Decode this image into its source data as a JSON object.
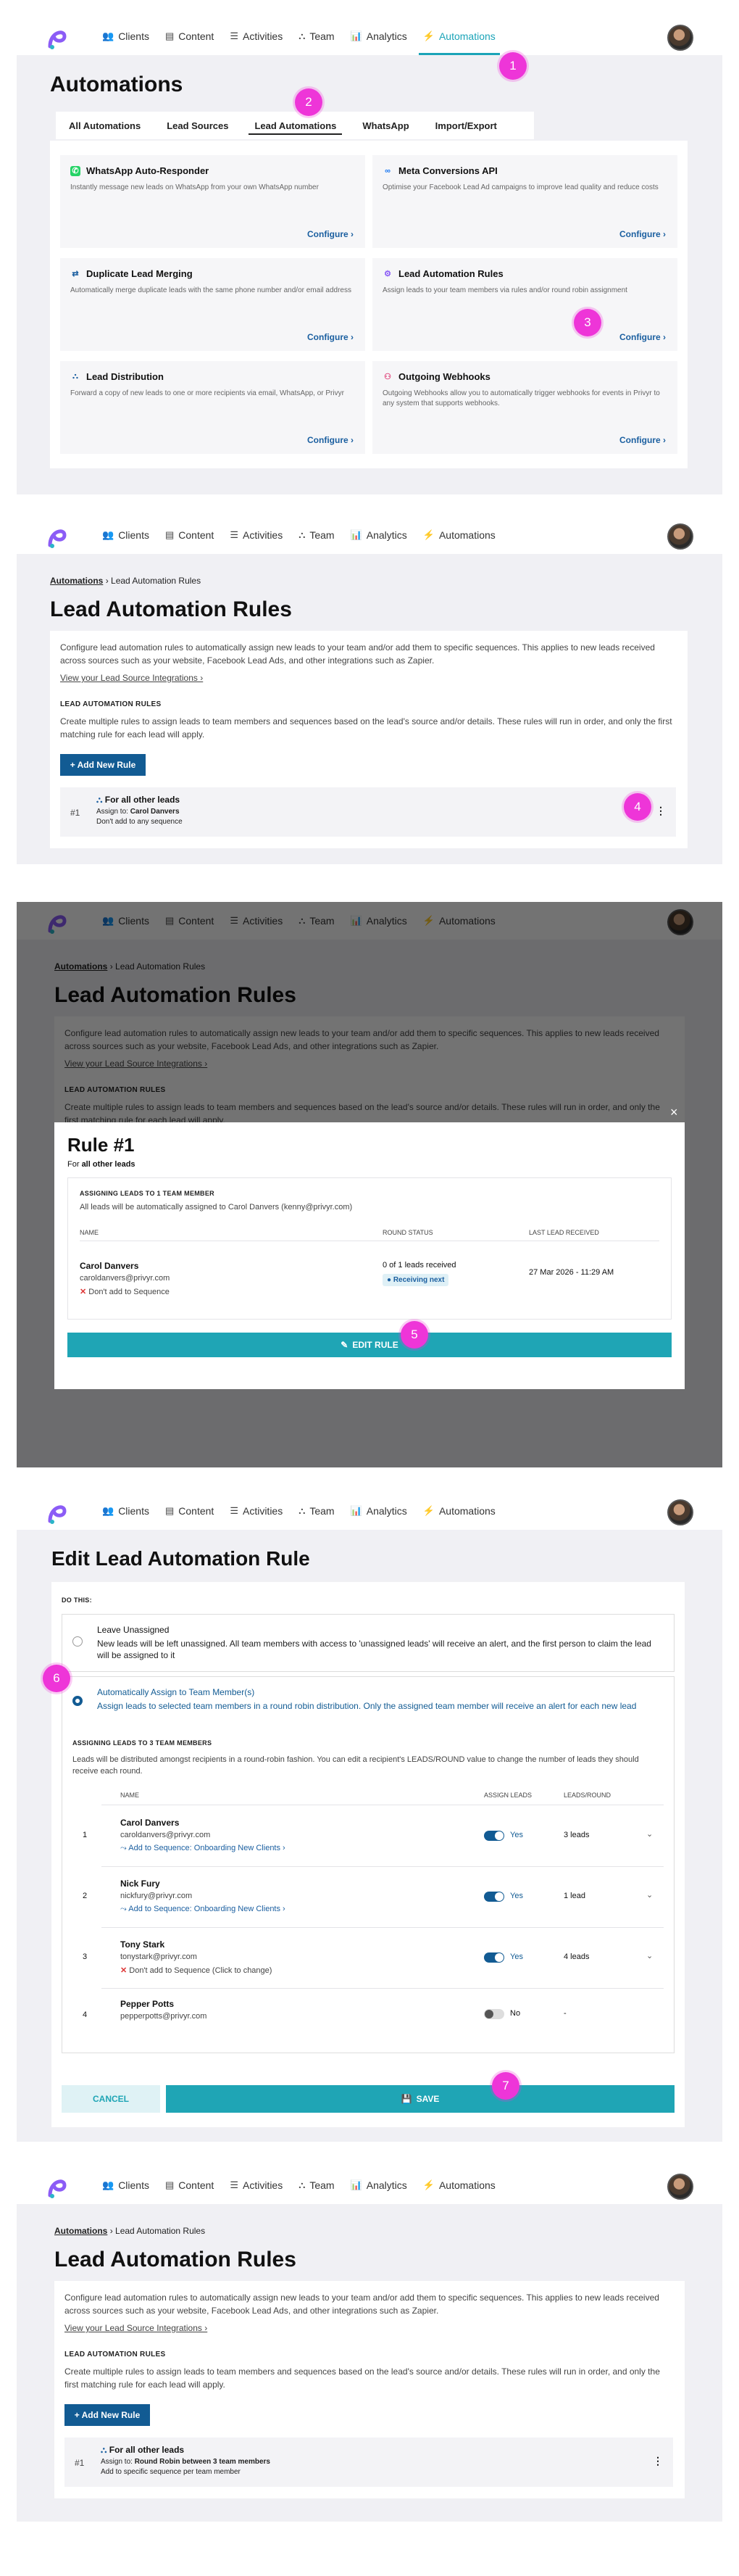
{
  "nav": {
    "items": [
      {
        "label": "Clients",
        "icon": "users-icon"
      },
      {
        "label": "Content",
        "icon": "document-icon"
      },
      {
        "label": "Activities",
        "icon": "list-icon"
      },
      {
        "label": "Team",
        "icon": "team-icon"
      },
      {
        "label": "Analytics",
        "icon": "chart-icon"
      },
      {
        "label": "Automations",
        "icon": "bolt-icon"
      }
    ]
  },
  "markers": [
    "1",
    "2",
    "3",
    "4",
    "5",
    "6",
    "7"
  ],
  "s1": {
    "title": "Automations",
    "tabs": [
      "All Automations",
      "Lead Sources",
      "Lead Automations",
      "WhatsApp",
      "Import/Export"
    ],
    "cards": [
      {
        "title": "WhatsApp Auto-Responder",
        "desc": "Instantly message new leads on WhatsApp from your own WhatsApp number",
        "action": "Configure ›"
      },
      {
        "title": "Meta Conversions API",
        "desc": "Optimise your Facebook Lead Ad campaigns to improve lead quality and reduce costs",
        "action": "Configure ›"
      },
      {
        "title": "Duplicate Lead Merging",
        "desc": "Automatically merge duplicate leads with the same phone number and/or email address",
        "action": "Configure ›"
      },
      {
        "title": "Lead Automation Rules",
        "desc": "Assign leads to your team members via rules and/or round robin assignment",
        "action": "Configure ›"
      },
      {
        "title": "Lead Distribution",
        "desc": "Forward a copy of new leads to one or more recipients via email, WhatsApp, or Privyr",
        "action": "Configure ›"
      },
      {
        "title": "Outgoing Webhooks",
        "desc": "Outgoing Webhooks allow you to automatically trigger webhooks for events in Privyr to any system that supports webhooks.",
        "action": "Configure ›"
      }
    ]
  },
  "rules_page": {
    "crumb_root": "Automations",
    "crumb_current": "› Lead Automation Rules",
    "title": "Lead Automation Rules",
    "desc": "Configure lead automation rules to automatically assign new leads to your team and/or add them to specific sequences. This applies to new leads received across sources such as your website, Facebook Lead Ads, and other integrations such as Zapier.",
    "link": "View your Lead Source Integrations ›",
    "section": "LEAD AUTOMATION RULES",
    "section_desc": "Create multiple rules to assign leads to team members and sequences based on the lead's source and/or details. These rules will run in order, and only the first matching rule for each lead will apply.",
    "add_btn": "+ Add New Rule",
    "rule_num": "#1",
    "rule_name": "For all other leads",
    "assign_label": "Assign to:",
    "dots": "⋮"
  },
  "s2_rule": {
    "assign": "Carol Danvers",
    "seq": "Don't add to any sequence"
  },
  "modal": {
    "title": "Rule #1",
    "for_prefix": "For",
    "for_bold": "all other leads",
    "assign_head": "ASSIGNING LEADS TO 1 TEAM MEMBER",
    "assign_desc": "All leads will be automatically assigned to Carol Danvers (kenny@privyr.com)",
    "cols": [
      "NAME",
      "ROUND STATUS",
      "LAST LEAD RECEIVED"
    ],
    "name": "Carol Danvers",
    "email": "caroldanvers@privyr.com",
    "seq": "Don't add to Sequence",
    "status": "0 of 1 leads received",
    "badge": "● Receiving next",
    "last": "27 Mar 2026 - 11:29 AM",
    "button": "EDIT RULE",
    "close": "×"
  },
  "edit": {
    "title": "Edit Lead Automation Rule",
    "do_this": "DO THIS:",
    "opt1_title": "Leave Unassigned",
    "opt1_desc": "New leads will be left unassigned. All team members with access to 'unassigned leads' will receive an alert, and the first person to claim the lead will be assigned to it",
    "opt2_title": "Automatically Assign to Team Member(s)",
    "opt2_desc": "Assign leads to selected team members in a round robin distribution. Only the assigned team member will receive an alert for each new lead",
    "assign_head": "ASSIGNING LEADS TO 3 TEAM MEMBERS",
    "assign_desc": "Leads will be distributed amongst recipients in a round-robin fashion. You can edit a recipient's LEADS/ROUND value to change the number of leads they should receive each round.",
    "cols": [
      "NAME",
      "ASSIGN LEADS",
      "LEADS/ROUND"
    ],
    "rows": [
      {
        "n": "1",
        "name": "Carol Danvers",
        "email": "caroldanvers@privyr.com",
        "seq": "Add to Sequence: Onboarding New Clients ›",
        "assign": "Yes",
        "per": "3 leads"
      },
      {
        "n": "2",
        "name": "Nick Fury",
        "email": "nickfury@privyr.com",
        "seq": "Add to Sequence: Onboarding New Clients ›",
        "assign": "Yes",
        "per": "1 lead"
      },
      {
        "n": "3",
        "name": "Tony Stark",
        "email": "tonystark@privyr.com",
        "seq": "Don't add to Sequence (Click to change)",
        "assign": "Yes",
        "per": "4 leads"
      },
      {
        "n": "4",
        "name": "Pepper Potts",
        "email": "pepperpotts@privyr.com",
        "seq": "",
        "assign": "No",
        "per": "-"
      }
    ],
    "cancel": "CANCEL",
    "save": "SAVE"
  },
  "s5_rule": {
    "assign": "Round Robin between 3 team members",
    "seq": "Add to specific sequence per team member"
  }
}
